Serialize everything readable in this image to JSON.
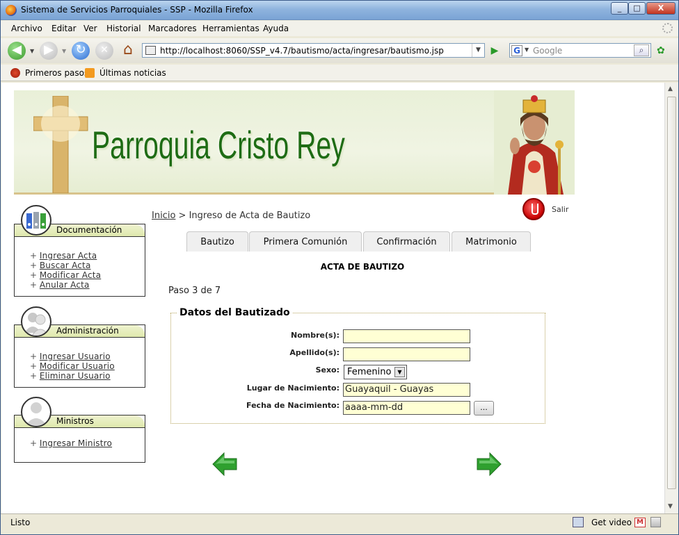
{
  "window": {
    "title": "Sistema de Servicios Parroquiales - SSP - Mozilla Firefox",
    "controls": [
      "_",
      "□",
      "X"
    ]
  },
  "menu": [
    "Archivo",
    "Editar",
    "Ver",
    "Historial",
    "Marcadores",
    "Herramientas",
    "Ayuda"
  ],
  "nav": {
    "url": "http://localhost:8060/SSP_v4.7/bautismo/acta/ingresar/bautismo.jsp",
    "search_placeholder": "Google"
  },
  "bookmarks": [
    "Primeros pasos",
    "Últimas noticias"
  ],
  "status": {
    "text": "Listo",
    "get_video": "Get video"
  },
  "page": {
    "banner_title": "Parroquia Cristo Rey",
    "breadcrumb": {
      "home": "Inicio",
      "separator": " > ",
      "current": "Ingreso de Acta de Bautizo"
    },
    "logout": "Salir",
    "tabs": [
      "Bautizo",
      "Primera Comunión",
      "Confirmación",
      "Matrimonio"
    ],
    "acta_title": "ACTA DE BAUTIZO",
    "step": "Paso 3 de 7",
    "section_title": "Datos del Bautizado",
    "fields": {
      "nombre_label": "Nombre(s):",
      "nombre_value": "",
      "apellido_label": "Apellido(s):",
      "apellido_value": "",
      "sexo_label": "Sexo:",
      "sexo_value": "Femenino",
      "lugar_label": "Lugar de Nacimiento:",
      "lugar_value": "Guayaquil - Guayas",
      "fecha_label": "Fecha de Nacimiento:",
      "fecha_value": "aaaa-mm-dd",
      "calendar_button": "..."
    }
  },
  "sidebar": {
    "documentacion": {
      "title": "Documentación",
      "items": [
        "Ingresar Acta",
        "Buscar Acta",
        "Modificar Acta",
        "Anular Acta"
      ]
    },
    "administracion": {
      "title": "Administración",
      "items": [
        "Ingresar Usuario",
        "Modificar Usuario",
        "Eliminar Usuario"
      ]
    },
    "ministros": {
      "title": "Ministros",
      "items": [
        "Ingresar Ministro"
      ]
    }
  },
  "colors": {
    "banner_title": "#1e6c14",
    "input_bg": "#ffffd4",
    "sidebar_header": "#e5edb9",
    "arrow_green": "#2fa02f"
  }
}
